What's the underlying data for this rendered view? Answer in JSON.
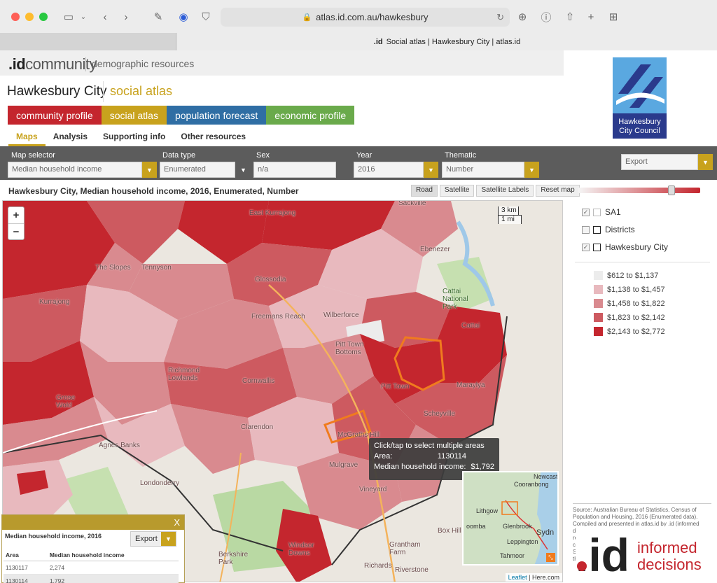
{
  "browser": {
    "url": "atlas.id.com.au/hawkesbury",
    "tab_title": "Social atlas | Hawkesbury City | atlas.id",
    "tab_favicon": ".id"
  },
  "header": {
    "brand_id": ".id",
    "brand_community": "community",
    "brand_sub": "demographic resources",
    "title": "Hawkesbury City",
    "title_section": "social atlas",
    "council_logo_line1": "Hawkesbury",
    "council_logo_line2": "City Council"
  },
  "nav": {
    "tabs": [
      {
        "label": "community profile",
        "color": "#c4262e"
      },
      {
        "label": "social atlas",
        "color": "#c8a21d"
      },
      {
        "label": "population forecast",
        "color": "#2f6ea4"
      },
      {
        "label": "economic profile",
        "color": "#6aaa4b"
      }
    ],
    "subtabs": [
      "Maps",
      "Analysis",
      "Supporting info",
      "Other resources"
    ]
  },
  "controls": {
    "map_selector_label": "Map selector",
    "map_selector_value": "Median household income",
    "data_type_label": "Data type",
    "data_type_value": "Enumerated",
    "sex_label": "Sex",
    "sex_value": "n/a",
    "year_label": "Year",
    "year_value": "2016",
    "thematic_label": "Thematic",
    "thematic_value": "Number",
    "export_value": "Export"
  },
  "map": {
    "title": "Hawkesbury City, Median household income, 2016, Enumerated, Number",
    "buttons": {
      "road": "Road",
      "satellite": "Satellite",
      "satellite_labels": "Satellite Labels",
      "reset": "Reset map"
    },
    "zoom_in": "+",
    "zoom_out": "−",
    "scale_km": "3 km",
    "scale_mi": "1 mi",
    "places": {
      "sackville": "Sackville",
      "east_kurrajong": "East Kurrajong",
      "the_slopes": "The Slopes",
      "tennyson": "Tennyson",
      "glossodia": "Glossodia",
      "ebenezer": "Ebenezer",
      "freemans_reach": "Freemans Reach",
      "wilberforce": "Wilberforce",
      "pitt_town_bottoms": "Pitt Town Bottoms",
      "cattai": "Cattai",
      "richmond_lowlands": "Richmond Lowlands",
      "cornwallis": "Cornwallis",
      "pitt_town": "Pitt Town",
      "maraylya": "Maraylya",
      "scheyville": "Scheyville",
      "grose_wold": "Grose Wold",
      "agnes_banks": "Agnes Banks",
      "clarendon": "Clarendon",
      "mcgraths_hill": "McGraths Hill",
      "mulgrave": "Mulgrave",
      "vineyard": "Vineyard",
      "londonderry": "Londonderry",
      "berkshire_park": "Berkshire Park",
      "windsor_downs": "Windsor Downs",
      "box_hill": "Box Hill",
      "grantham_farm": "Grantham Farm",
      "riverstone": "Riverstone",
      "richards": "Richards",
      "kurrajong": "Kurrajong",
      "cattai_national_park": "Cattai National Park"
    },
    "tooltip": {
      "heading": "Click/tap to select multiple areas",
      "area_label": "Area:",
      "area_value": "1130114",
      "income_label": "Median household income:",
      "income_value": "$1,792"
    },
    "inset": {
      "newcastle": "Newcast",
      "cooranbong": "Cooranbong",
      "lithgow": "Lithgow",
      "katoomba": "oomba",
      "glenbrook": "Glenbrook",
      "sydney": "Sydn",
      "leppington": "Leppington",
      "tahmoor": "Tahmoor"
    },
    "attribution_leaflet": "Leaflet",
    "attribution_rest": "| Here.com"
  },
  "popup": {
    "close": "X",
    "title": "Median household income, 2016",
    "export": "Export",
    "columns": [
      "Area",
      "Median household income"
    ],
    "rows": [
      [
        "1130117",
        "2,274"
      ],
      [
        "1130114",
        "1,792"
      ]
    ]
  },
  "panel": {
    "layers": [
      {
        "label": "SA1",
        "checked": true
      },
      {
        "label": "Districts",
        "checked": false
      },
      {
        "label": "Hawkesbury City",
        "checked": true
      }
    ],
    "legend": [
      {
        "label": "$612 to $1,137",
        "color": "#ececec"
      },
      {
        "label": "$1,138 to $1,457",
        "color": "#e8b9be"
      },
      {
        "label": "$1,458 to $1,822",
        "color": "#d98a8f"
      },
      {
        "label": "$1,823 to $2,142",
        "color": "#cd5a60"
      },
      {
        "label": "$2,143 to $2,772",
        "color": "#c4262e"
      }
    ],
    "source": "Source: Australian Bureau of Statistics, Census of Population and Housing, 2016 (Enumerated data). Compiled and presented in atlas.id by .id (informed decisions). Note: Due to changes in the ABS rules regarding perturbation of small numbers to protect the confidentiality of individuals in 2016, the totals of all SA1s in an area may not equal the total derived from the area as a whole."
  },
  "footer_logo": {
    "id": ".id",
    "line1": "informed",
    "line2": "decisions"
  }
}
